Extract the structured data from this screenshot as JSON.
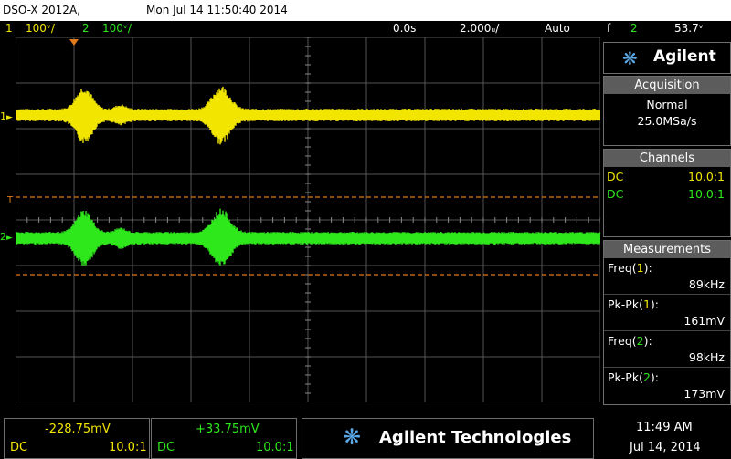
{
  "title_bar": {
    "model": "DSO-X 2012A,",
    "datetime": "Mon Jul 14 11:50:40 2014"
  },
  "status_bar": {
    "ch1_num": "1",
    "ch1_scale": "100ᵛ/",
    "ch2_num": "2",
    "ch2_scale": "100ᵛ/",
    "time_delay": "0.0s",
    "time_scale": "2.000ᵤ/",
    "trigger_mode": "Auto",
    "trigger_edge": "ſ",
    "trigger_source": "2",
    "trigger_level": "53.7ᵛ"
  },
  "markers": {
    "ch1": "1",
    "ch2": "2",
    "trigger": "T"
  },
  "panel": {
    "brand": "Agilent",
    "acquisition": {
      "header": "Acquisition",
      "mode": "Normal",
      "rate": "25.0MSa/s"
    },
    "channels": {
      "header": "Channels",
      "rows": [
        {
          "coupling": "DC",
          "probe": "10.0:1"
        },
        {
          "coupling": "DC",
          "probe": "10.0:1"
        }
      ]
    },
    "measurements": {
      "header": "Measurements",
      "items": [
        {
          "label_pre": "Freq(",
          "ch": "1",
          "label_post": "):",
          "value": "89kHz"
        },
        {
          "label_pre": "Pk-Pk(",
          "ch": "1",
          "label_post": "):",
          "value": "161mV"
        },
        {
          "label_pre": "Freq(",
          "ch": "2",
          "label_post": "):",
          "value": "98kHz"
        },
        {
          "label_pre": "Pk-Pk(",
          "ch": "2",
          "label_post": "):",
          "value": "173mV"
        }
      ]
    }
  },
  "bottom": {
    "ch1": {
      "offset": "-228.75mV",
      "coupling": "DC",
      "probe": "10.0:1"
    },
    "ch2": {
      "offset": "+33.75mV",
      "coupling": "DC",
      "probe": "10.0:1"
    },
    "brand": "Agilent Technologies",
    "time": "11:49 AM",
    "date": "Jul 14, 2014"
  },
  "colors": {
    "ch1": "#f2e600",
    "ch2": "#2ee81c",
    "trigger_level_line": "#e07a1a",
    "grid": "#555555",
    "panel_header": "#5c5c5c"
  }
}
